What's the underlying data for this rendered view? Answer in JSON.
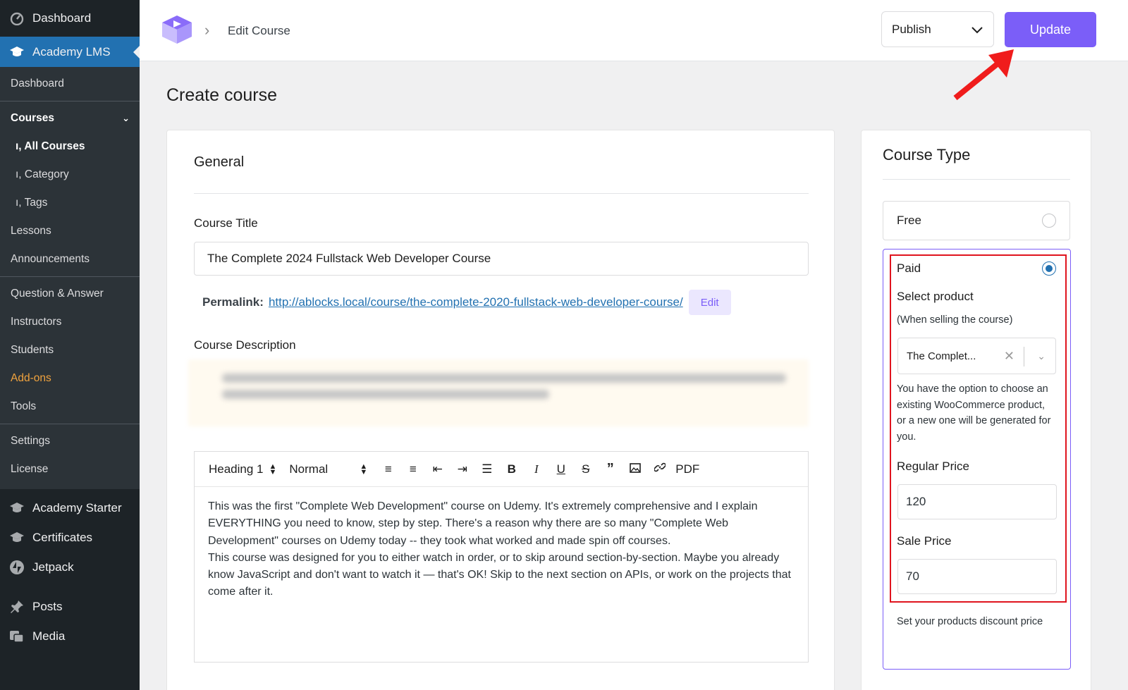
{
  "sidebar": {
    "top_label": "Dashboard",
    "active_label": "Academy LMS",
    "dashboard": "Dashboard",
    "courses": "Courses",
    "all_courses": "ı, All Courses",
    "category": "ı, Category",
    "tags": "ı, Tags",
    "lessons": "Lessons",
    "announcements": "Announcements",
    "qa": "Question & Answer",
    "instructors": "Instructors",
    "students": "Students",
    "addons": "Add-ons",
    "tools": "Tools",
    "settings": "Settings",
    "license": "License",
    "academy_starter": "Academy Starter",
    "certificates": "Certificates",
    "jetpack": "Jetpack",
    "posts": "Posts",
    "media": "Media"
  },
  "header": {
    "breadcrumb": "Edit Course",
    "publish_value": "Publish",
    "update_label": "Update"
  },
  "page_title": "Create course",
  "general": {
    "heading": "General",
    "title_label": "Course Title",
    "title_value": "The Complete 2024 Fullstack Web Developer Course",
    "permalink_label": "Permalink:",
    "permalink_url": "http://ablocks.local/course/the-complete-2020-fullstack-web-developer-course/",
    "edit_label": "Edit",
    "description_label": "Course Description",
    "toolbar": {
      "heading_select": "Heading 1",
      "size_select": "Normal",
      "pdf": "PDF"
    },
    "editor_text_1": "This was the first \"Complete Web Development\" course on Udemy. It's extremely comprehensive and I explain EVERYTHING you need to know, step by step. There's a reason why there are so many \"Complete Web Development\" courses on Udemy today -- they took what worked and made spin off courses.",
    "editor_text_2": "This course was designed for you to either watch in order, or to skip around section-by-section. Maybe you already know JavaScript and don't want to watch it — that's OK! Skip to the next section on APIs, or work on the projects that come after it."
  },
  "course_type": {
    "heading": "Course Type",
    "free_label": "Free",
    "paid_label": "Paid",
    "select_product": "Select product",
    "selling_note": "(When selling the course)",
    "product_value": "The Complet...",
    "product_help": "You have the option to choose an existing WooCommerce product, or a new one will be generated for you.",
    "regular_price_label": "Regular Price",
    "regular_price": "120",
    "sale_price_label": "Sale Price",
    "sale_price": "70",
    "sale_help": "Set your products discount price"
  },
  "colors": {
    "accent": "#7b5ef8",
    "wp_blue": "#2271b1",
    "highlight_red": "#e0141e"
  }
}
